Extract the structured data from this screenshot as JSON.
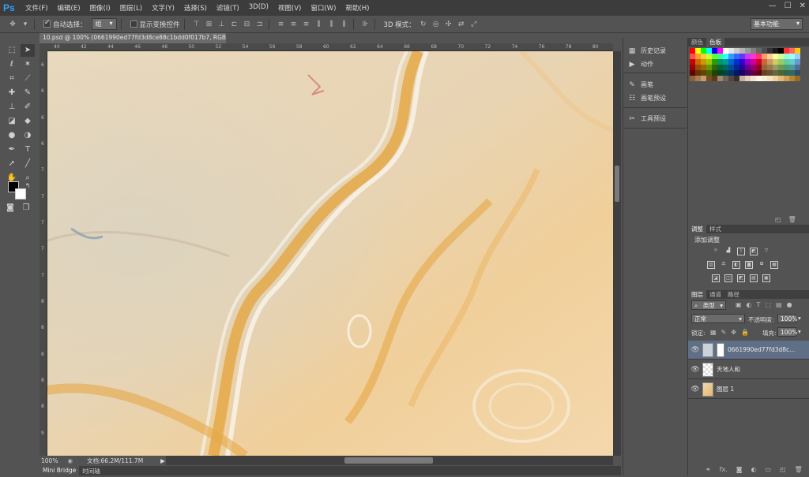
{
  "app": {
    "logo": "Ps"
  },
  "menu": [
    "文件(F)",
    "编辑(E)",
    "图像(I)",
    "图层(L)",
    "文字(Y)",
    "选择(S)",
    "滤镜(T)",
    "3D(D)",
    "视图(V)",
    "窗口(W)",
    "帮助(H)"
  ],
  "window_controls": {
    "minimize": "—",
    "maximize": "☐",
    "close": "✕"
  },
  "options": {
    "auto_select_label": "自动选择：",
    "auto_select_value": "组",
    "show_transform_label": "显示变换控件",
    "mode_3d_label": "3D 模式：",
    "workspace": "基本功能"
  },
  "document": {
    "tab_title": "10.psd @ 100% (0661990ed77fd3d8ce88c1bdd0f017b7, RGB/8)",
    "tab_close": "×",
    "zoom": "100%",
    "doc_info": "文档:66.2M/111.7M",
    "ruler_top_ticks": [
      "40",
      "42",
      "44",
      "46",
      "48",
      "50",
      "52",
      "54",
      "56",
      "58",
      "60",
      "62",
      "64",
      "66",
      "68",
      "70",
      "72",
      "74",
      "76",
      "78",
      "80"
    ],
    "ruler_left_ticks": [
      "6",
      "6",
      "6",
      "6",
      "7",
      "7",
      "7",
      "7",
      "7",
      "8",
      "8",
      "8",
      "8",
      "8",
      "9"
    ]
  },
  "bottom_tabs": [
    "Mini Bridge",
    "时间轴"
  ],
  "mid_panels": {
    "items": [
      "历史记录",
      "动作",
      "画笔",
      "画笔预设",
      "工具预设"
    ]
  },
  "color_panel": {
    "tabs": [
      "颜色",
      "色板"
    ],
    "active": "色板"
  },
  "swatch_colors": [
    "#ff0000",
    "#ffff00",
    "#00ff00",
    "#00ffff",
    "#0000ff",
    "#ff00ff",
    "#ffffff",
    "#e6e6e6",
    "#cccccc",
    "#b3b3b3",
    "#999999",
    "#808080",
    "#666666",
    "#4d4d4d",
    "#333333",
    "#1a1a1a",
    "#000000",
    "#ff3333",
    "#ff6666",
    "#ffcc00",
    "#ff5050",
    "#ff9933",
    "#ffcc33",
    "#ccff33",
    "#66ff33",
    "#33ff99",
    "#33ffff",
    "#3399ff",
    "#3366ff",
    "#6633ff",
    "#cc33ff",
    "#ff33cc",
    "#ff3366",
    "#ff9966",
    "#ffcc99",
    "#ffff99",
    "#ccff99",
    "#99ffcc",
    "#99ffff",
    "#99ccff",
    "#cc0000",
    "#cc6600",
    "#cc9900",
    "#99cc00",
    "#339900",
    "#009966",
    "#009999",
    "#0066cc",
    "#0033cc",
    "#3300cc",
    "#9900cc",
    "#cc0099",
    "#cc0033",
    "#cc6633",
    "#cc9966",
    "#cccc66",
    "#99cc66",
    "#66cc99",
    "#66cccc",
    "#6699cc",
    "#990000",
    "#994c00",
    "#996600",
    "#669900",
    "#336600",
    "#006633",
    "#006666",
    "#004c99",
    "#002699",
    "#260099",
    "#660099",
    "#990066",
    "#990026",
    "#996633",
    "#997a4d",
    "#999966",
    "#6e994d",
    "#4d9970",
    "#4d9999",
    "#4d7099",
    "#660000",
    "#663300",
    "#664400",
    "#446600",
    "#224400",
    "#004422",
    "#004444",
    "#003366",
    "#001966",
    "#190066",
    "#440066",
    "#660044",
    "#660019",
    "#664422",
    "#665233",
    "#666644",
    "#496633",
    "#33664b",
    "#336666",
    "#334b66",
    "#8c6239",
    "#a67c52",
    "#c69c6d",
    "#754c24",
    "#603913",
    "#998675",
    "#736357",
    "#534741",
    "#362f2d",
    "#c7b299",
    "#e2d1b8",
    "#f2e6d2",
    "#fff7e8",
    "#fbf0d9",
    "#f7e4bf",
    "#efd29f",
    "#e2b975",
    "#d19f50",
    "#b98535",
    "#9b6b22"
  ],
  "adjust_panel": {
    "tabs": [
      "调整",
      "样式"
    ],
    "title": "添加调整"
  },
  "layers_panel": {
    "tabs": [
      "图层",
      "通道",
      "路径"
    ],
    "filter_label": "类型",
    "blend_mode": "正常",
    "opacity_label": "不透明度:",
    "opacity_value": "100%",
    "lock_label": "锁定:",
    "fill_label": "填充:",
    "fill_value": "100%",
    "layers": [
      {
        "name": "0661990ed77fd3d8c...",
        "selected": true
      },
      {
        "name": "天地人和",
        "selected": false
      },
      {
        "name": "图层 1",
        "selected": false
      }
    ]
  }
}
